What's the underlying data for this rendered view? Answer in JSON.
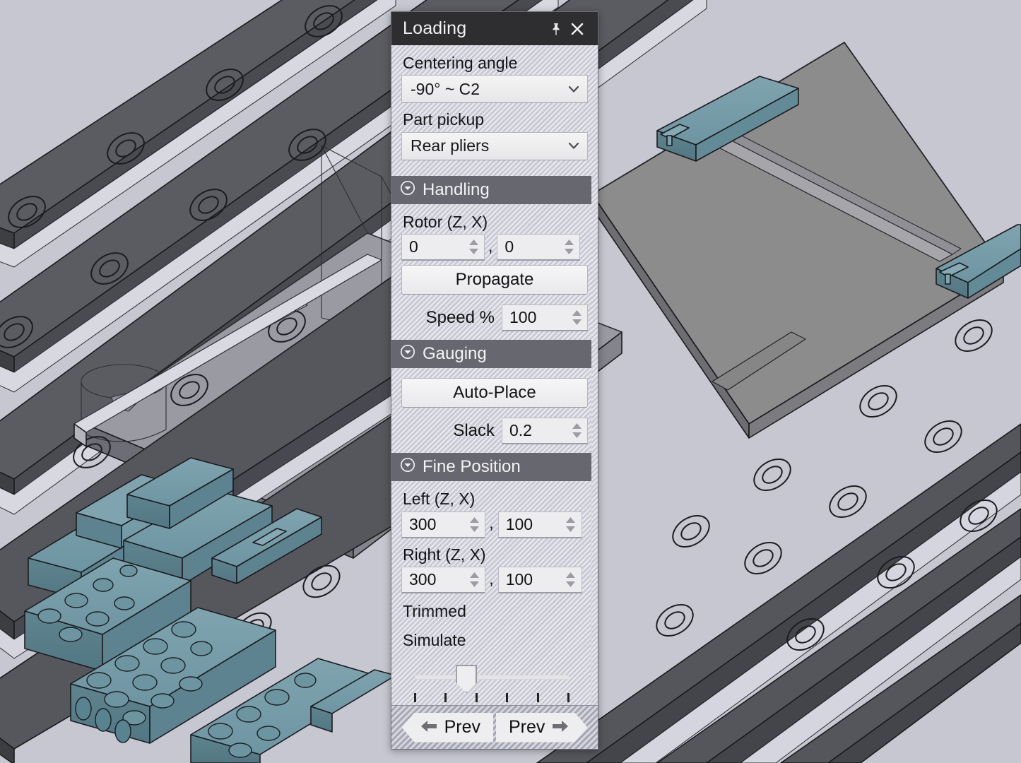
{
  "window": {
    "title": "Loading",
    "pin_icon": "pin-icon",
    "close_icon": "close-icon"
  },
  "colors": {
    "viewport_background": "#c6c7d1",
    "panel_background": "#d2d3dc",
    "titlebar_background": "#2e2e31",
    "section_header_background": "#67686f",
    "rail_dark": "#4a4b4f",
    "rail_mid": "#636469",
    "part_teal": "#6f97a3",
    "sheet_gray": "#8d8d8d"
  },
  "top_fields": {
    "centering_angle": {
      "label": "Centering angle",
      "value": "-90° ~ C2",
      "chevron_icon": "chevron-down-icon"
    },
    "part_pickup": {
      "label": "Part pickup",
      "value": "Rear pliers",
      "chevron_icon": "chevron-down-icon"
    }
  },
  "sections": {
    "handling": {
      "title": "Handling",
      "collapse_icon": "chevron-down-circle-icon",
      "rotor": {
        "label": "Rotor (Z, X)",
        "z": "0",
        "x": "0",
        "separator": ","
      },
      "propagate_label": "Propagate",
      "speed": {
        "label": "Speed %",
        "value": "100"
      }
    },
    "gauging": {
      "title": "Gauging",
      "collapse_icon": "chevron-down-circle-icon",
      "auto_place_label": "Auto-Place",
      "slack": {
        "label": "Slack",
        "value": "0.2"
      }
    },
    "fine_position": {
      "title": "Fine Position",
      "collapse_icon": "chevron-down-circle-icon",
      "left": {
        "label": "Left (Z, X)",
        "z": "300",
        "x": "100",
        "separator": ","
      },
      "right": {
        "label": "Right (Z, X)",
        "z": "300",
        "x": "100",
        "separator": ","
      },
      "trimmed_label": "Trimmed",
      "simulate_label": "Simulate",
      "slider": {
        "value_percent": 33,
        "tick_count": 6
      }
    }
  },
  "footer": {
    "prev_label": "Prev",
    "next_label": "Prev",
    "prev_icon": "arrow-left-icon",
    "next_icon": "arrow-right-icon"
  }
}
